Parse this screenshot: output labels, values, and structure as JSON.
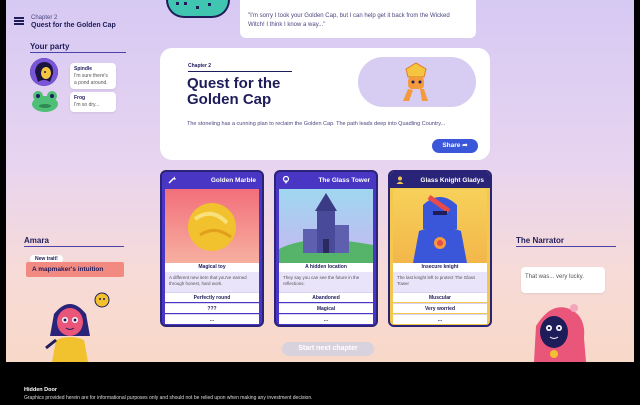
{
  "header": {
    "chapter_small": "Chapter 2",
    "chapter_title": "Quest for the Golden Cap"
  },
  "party": {
    "title": "Your party",
    "members": [
      {
        "name": "Spindle",
        "line": "I'm sure there's a pond around."
      },
      {
        "name": "Frog",
        "line": "I'm so dry..."
      }
    ]
  },
  "dialog": {
    "text": "\"I'm sorry I took your Golden Cap, but I can help get it back from the Wicked Witch! I think I know a way...\""
  },
  "quest": {
    "chapter": "Chapter 2",
    "title": "Quest for the Golden Cap",
    "description": "The stoneling has a cunning plan to reclaim the Golden Cap. The path leads deep into Quadling Country...",
    "share_label": "Share"
  },
  "cards": [
    {
      "title": "Golden Marble",
      "caption": "Magical toy",
      "text": "A different new item that you've earned through honest, hard work.",
      "options": [
        "Perfectly round",
        "???",
        "..."
      ],
      "color": "#4a36c4"
    },
    {
      "title": "The Glass Tower",
      "caption": "A hidden location",
      "text": "They say you can see the future in the reflections.",
      "options": [
        "Abandoned",
        "Magical",
        "..."
      ],
      "color": "#4a36c4"
    },
    {
      "title": "Glass Knight Gladys",
      "caption": "Insecure knight",
      "text": "The last knight left to protect The Glass Tower",
      "options": [
        "Muscular",
        "Very worried",
        "..."
      ],
      "color": "#f2c94c"
    }
  ],
  "amara": {
    "title": "Amara",
    "trait_badge": "New trait!",
    "trait": "A mapmaker's intuition"
  },
  "narrator": {
    "title": "The Narrator",
    "line": "That was... very lucky."
  },
  "next_chapter_label": "Start next chapter",
  "footer": {
    "title": "Hidden Door",
    "disclaimer": "Graphics provided herein are for informational purposes only and should not be relied upon when making any investment decision."
  }
}
